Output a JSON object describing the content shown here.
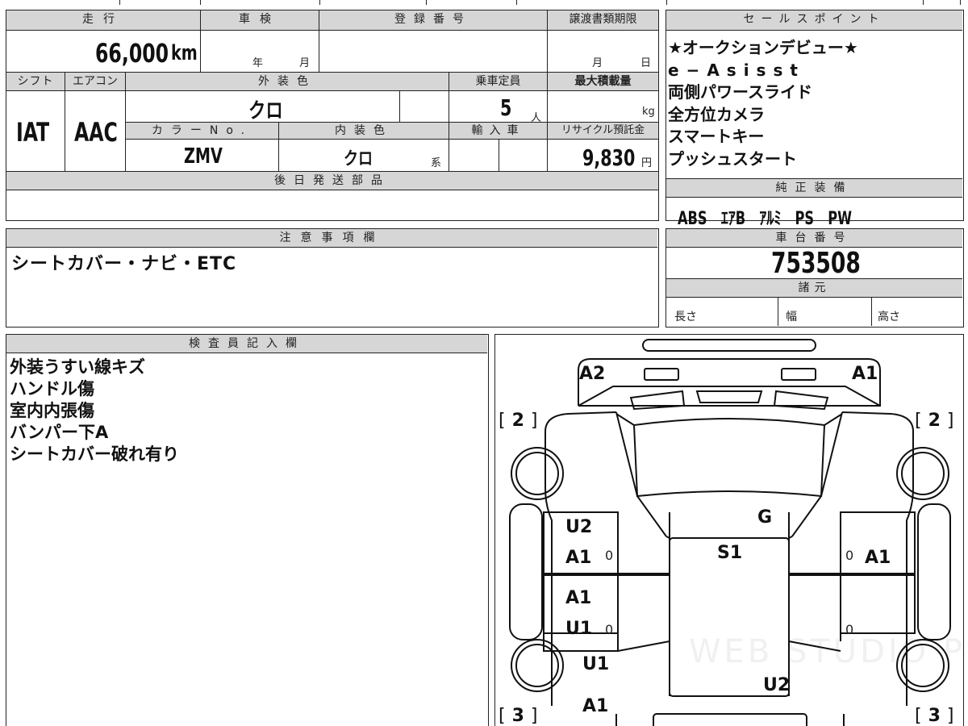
{
  "header": {
    "mileage_label": "走行",
    "shaken_label": "車検",
    "reg_number_label": "登録番号",
    "transfer_deadline_label": "譲渡書類期限",
    "sales_point_label": "セールスポイント"
  },
  "vehicle": {
    "mileage_value": "66,000",
    "mileage_unit": "km",
    "shaken_year_unit": "年",
    "shaken_month_unit": "月",
    "deadline_month_unit": "月",
    "deadline_day_unit": "日",
    "shift_label": "シフト",
    "aircon_label": "エアコン",
    "exterior_color_label": "外装色",
    "capacity_label": "乗車定員",
    "max_load_label": "最大積載量",
    "shift_value": "IAT",
    "aircon_value": "AAC",
    "exterior_color_value": "クロ",
    "capacity_value": "5",
    "capacity_unit": "人",
    "max_load_unit": "kg",
    "color_no_label": "カラーNo.",
    "interior_color_label": "内装色",
    "import_label": "輸入車",
    "recycle_label": "リサイクル預託金",
    "color_no_value": "ZMV",
    "interior_color_value": "クロ",
    "interior_color_suffix": "系",
    "recycle_value": "9,830",
    "recycle_unit": "円",
    "later_parts_label": "後日発送部品"
  },
  "sales_points": {
    "items": [
      "★オークションデビュー★",
      "e−Asisst",
      "両側パワースライド",
      "全方位カメラ",
      "スマートキー",
      "プッシュスタート"
    ]
  },
  "genuine_equipment": {
    "label": "純正装備",
    "items": [
      "ABS",
      "ｴｱB",
      "ｱﾙﾐ",
      "PS",
      "PW"
    ]
  },
  "notes": {
    "label": "注意事項欄",
    "text": "シートカバー・ナビ・ETC"
  },
  "chassis": {
    "label": "車台番号",
    "number": "753508",
    "specs_label": "諸元",
    "length_label": "長さ",
    "width_label": "幅",
    "height_label": "高さ"
  },
  "inspector": {
    "label": "検査員記入欄",
    "lines": [
      "外装うすい線キズ",
      "ハンドル傷",
      "室内内張傷",
      "バンパー下A",
      "シートカバー破れ有り"
    ]
  },
  "diagram": {
    "marks": {
      "front_left": "A2",
      "front_right": "A1",
      "tire_fl": "2",
      "tire_fr": "2",
      "tire_rl": "3",
      "tire_rr": "3",
      "left_front_door_1": "U2",
      "left_front_door_2": "A1",
      "left_rear_door_1": "A1",
      "left_rear_door_2": "U1",
      "left_rear_fender": "U1",
      "rear_left": "A1",
      "glass": "G",
      "roof": "S1",
      "right_front_door": "A1",
      "rear_right": "U2",
      "zero_1": "0",
      "zero_2": "0",
      "zero_3": "0",
      "zero_4": "0"
    },
    "watermark": "WEB STUDIO Pro"
  }
}
